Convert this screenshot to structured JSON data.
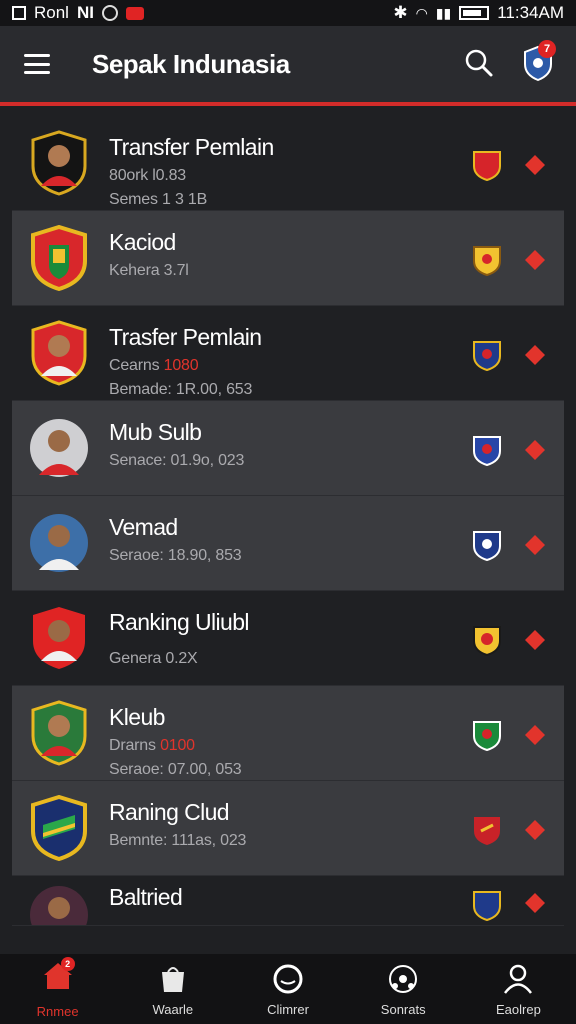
{
  "status_bar": {
    "left_text": "Ronl",
    "left_text2": "NI",
    "time": "11:34AM"
  },
  "app_bar": {
    "title": "Sepak Indunasia",
    "notification_count": "7"
  },
  "colors": {
    "accent": "#d32c2a",
    "row_alt": "#3a3b3f",
    "background": "#1f2023"
  },
  "rows": [
    {
      "name": "Transfer Pemlain",
      "sub1": "80ork l0.83",
      "sub1_highlight": "",
      "sub2": "Semes 1 3 1B",
      "avatar": "player-icon",
      "crest": "club-crest-icon"
    },
    {
      "name": "Kaciod",
      "sub1": "Kehera 3.7l",
      "sub1_highlight": "",
      "sub2": "",
      "avatar": "club-logo-icon",
      "crest": "club-crest-icon"
    },
    {
      "name": "Trasfer Pemlain",
      "sub1": "Cearns ",
      "sub1_highlight": "1080",
      "sub2": "Bemade: 1R.00, 653",
      "avatar": "player-icon",
      "crest": "club-crest-icon"
    },
    {
      "name": "Mub Sulb",
      "sub1": "Senace: 01.9o, 023",
      "sub1_highlight": "",
      "sub2": "",
      "avatar": "player-icon",
      "crest": "club-crest-icon"
    },
    {
      "name": "Vemad",
      "sub1": "Seraoe: 18.90, 853",
      "sub1_highlight": "",
      "sub2": "",
      "avatar": "player-icon",
      "crest": "club-crest-icon"
    },
    {
      "name": "Ranking Uliubl",
      "sub1": "Genera 0.2X",
      "sub1_highlight": "",
      "sub2": "",
      "avatar": "player-icon",
      "crest": "club-crest-icon"
    },
    {
      "name": "Kleub",
      "sub1": "Drarns ",
      "sub1_highlight": "0100",
      "sub2": "Seraoe: 07.00, 053",
      "avatar": "player-icon",
      "crest": "club-crest-icon"
    },
    {
      "name": "Raning Clud",
      "sub1": "Bemnte: 111as, 023",
      "sub1_highlight": "",
      "sub2": "",
      "avatar": "club-logo-icon",
      "crest": "club-crest-icon"
    },
    {
      "name": "Baltried",
      "sub1": "",
      "sub1_highlight": "",
      "sub2": "",
      "avatar": "player-icon",
      "crest": "club-crest-icon"
    }
  ],
  "bottom_nav": [
    {
      "label": "Rnmee",
      "icon": "home-icon",
      "active": true,
      "badge": "2"
    },
    {
      "label": "Waarle",
      "icon": "bag-icon",
      "active": false
    },
    {
      "label": "Climrer",
      "icon": "ball-icon",
      "active": false
    },
    {
      "label": "Sonrats",
      "icon": "team-icon",
      "active": false
    },
    {
      "label": "Eaolrep",
      "icon": "profile-icon",
      "active": false
    }
  ]
}
